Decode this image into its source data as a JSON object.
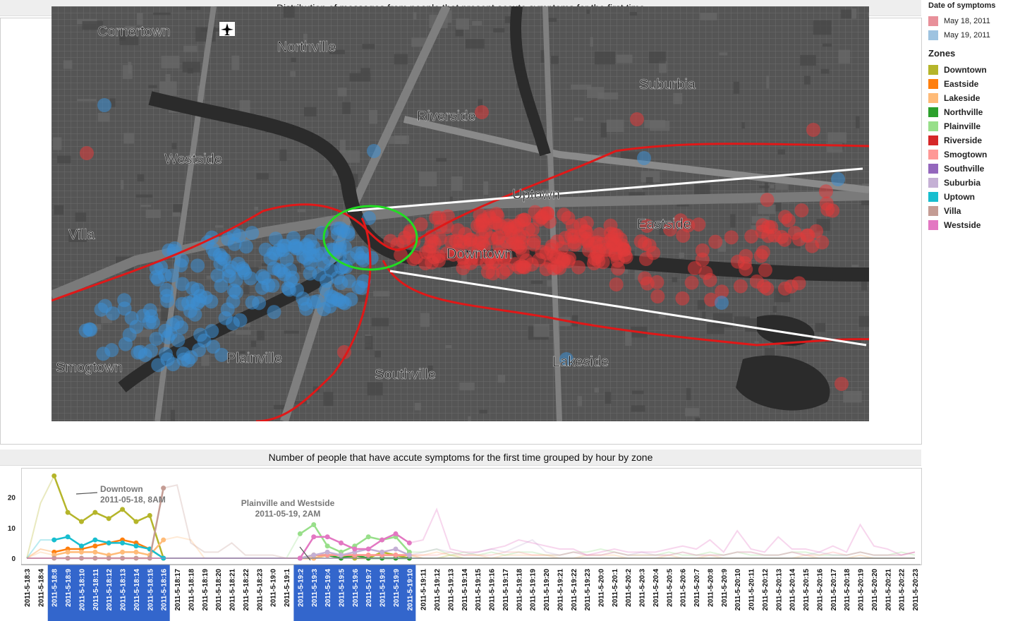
{
  "map_title": "Distribution of messages from people that present accute symptoms for the first time",
  "chart_title": "Number of people that have accute symptoms for the first time grouped by hour by zone",
  "legend_date": {
    "title": "Date of symptoms",
    "items": [
      {
        "label": "May 18, 2011",
        "color": "#e8909a"
      },
      {
        "label": "May 19, 2011",
        "color": "#9ec3e0"
      }
    ]
  },
  "legend_zones": {
    "title": "Zones",
    "items": [
      {
        "label": "Downtown",
        "color": "#b5b52a"
      },
      {
        "label": "Eastside",
        "color": "#ff7f0e"
      },
      {
        "label": "Lakeside",
        "color": "#ffbb78"
      },
      {
        "label": "Northville",
        "color": "#2ca02c"
      },
      {
        "label": "Plainville",
        "color": "#98df8a"
      },
      {
        "label": "Riverside",
        "color": "#d62728"
      },
      {
        "label": "Smogtown",
        "color": "#ff9896"
      },
      {
        "label": "Southville",
        "color": "#9467bd"
      },
      {
        "label": "Suburbia",
        "color": "#c5b0d5"
      },
      {
        "label": "Uptown",
        "color": "#17becf"
      },
      {
        "label": "Villa",
        "color": "#c49c94"
      },
      {
        "label": "Westside",
        "color": "#e377c2"
      }
    ]
  },
  "map_labels": [
    "Cornertown",
    "Northville",
    "Westside",
    "Villa",
    "Riverside",
    "Suburbia",
    "Uptown",
    "Eastside",
    "Downtown",
    "Smogtown",
    "Plainville",
    "Southville",
    "Lakeside"
  ],
  "annotations": {
    "downtown": {
      "line1": "Downtown",
      "line2": "2011-05-18, 8AM"
    },
    "plainville": {
      "line1": "Plainville and Westside",
      "line2": "2011-05-19, 2AM"
    }
  },
  "chart_data": {
    "type": "line",
    "title": "Number of people that have accute symptoms for the first time grouped by hour by zone",
    "yticks": [
      0,
      10,
      20
    ],
    "ylim": [
      0,
      28
    ],
    "x": [
      "2011-5-18:3",
      "2011-5-18:4",
      "2011-5-18:8",
      "2011-5-18:9",
      "2011-5-18:10",
      "2011-5-18:11",
      "2011-5-18:12",
      "2011-5-18:13",
      "2011-5-18:14",
      "2011-5-18:15",
      "2011-5-18:16",
      "2011-5-18:17",
      "2011-5-18:18",
      "2011-5-18:19",
      "2011-5-18:20",
      "2011-5-18:21",
      "2011-5-18:22",
      "2011-5-18:23",
      "2011-5-19:0",
      "2011-5-19:1",
      "2011-5-19:2",
      "2011-5-19:3",
      "2011-5-19:4",
      "2011-5-19:5",
      "2011-5-19:6",
      "2011-5-19:7",
      "2011-5-19:8",
      "2011-5-19:9",
      "2011-5-19:10",
      "2011-5-19:11",
      "2011-5-19:12",
      "2011-5-19:13",
      "2011-5-19:14",
      "2011-5-19:15",
      "2011-5-19:16",
      "2011-5-19:17",
      "2011-5-19:18",
      "2011-5-19:19",
      "2011-5-19:20",
      "2011-5-19:21",
      "2011-5-19:22",
      "2011-5-19:23",
      "2011-5-20:0",
      "2011-5-20:1",
      "2011-5-20:2",
      "2011-5-20:3",
      "2011-5-20:4",
      "2011-5-20:5",
      "2011-5-20:6",
      "2011-5-20:7",
      "2011-5-20:8",
      "2011-5-20:9",
      "2011-5-20:10",
      "2011-5-20:11",
      "2011-5-20:12",
      "2011-5-20:13",
      "2011-5-20:14",
      "2011-5-20:15",
      "2011-5-20:16",
      "2011-5-20:17",
      "2011-5-20:18",
      "2011-5-20:19",
      "2011-5-20:20",
      "2011-5-20:21",
      "2011-5-20:22",
      "2011-5-20:23"
    ],
    "highlighted_ranges": [
      [
        2,
        10
      ],
      [
        20,
        28
      ]
    ],
    "series": [
      {
        "name": "Downtown",
        "color": "#b5b52a",
        "values": [
          0,
          18,
          27,
          15,
          12,
          15,
          13,
          16,
          12,
          14,
          0,
          0,
          0,
          0,
          0,
          0,
          0,
          0,
          0,
          0,
          0,
          1,
          1,
          1,
          0,
          0,
          2,
          1,
          0,
          0,
          0,
          1,
          0,
          0,
          0,
          0,
          0,
          0,
          0,
          0,
          0,
          0,
          0,
          0,
          0,
          0,
          0,
          0,
          0,
          0,
          0,
          0,
          0,
          0,
          0,
          0,
          0,
          0,
          0,
          0,
          0,
          0,
          0,
          0,
          0,
          0
        ]
      },
      {
        "name": "Eastside",
        "color": "#ff7f0e",
        "values": [
          0,
          3,
          2,
          3,
          3,
          4,
          5,
          6,
          5,
          3,
          0,
          0,
          0,
          0,
          0,
          0,
          0,
          0,
          0,
          0,
          0,
          0,
          1,
          1,
          1,
          1,
          1,
          1,
          1,
          0,
          0,
          0,
          0,
          0,
          0,
          0,
          0,
          0,
          0,
          0,
          0,
          0,
          0,
          0,
          0,
          0,
          0,
          0,
          0,
          0,
          0,
          0,
          0,
          0,
          0,
          0,
          0,
          0,
          0,
          0,
          0,
          0,
          0,
          0,
          0,
          0
        ]
      },
      {
        "name": "Lakeside",
        "color": "#ffbb78",
        "values": [
          0,
          2,
          1,
          2,
          2,
          2,
          1,
          2,
          2,
          1,
          6,
          7,
          6,
          0,
          0,
          0,
          0,
          0,
          0,
          0,
          0,
          0,
          1,
          1,
          1,
          1,
          1,
          1,
          1,
          1,
          2,
          1,
          1,
          1,
          0,
          1,
          1,
          1,
          1,
          0,
          0,
          1,
          1,
          1,
          0,
          0,
          0,
          1,
          0,
          0,
          1,
          0,
          0,
          0,
          0,
          0,
          0,
          1,
          0,
          0,
          0,
          1,
          0,
          0,
          0,
          0
        ]
      },
      {
        "name": "Northville",
        "color": "#2ca02c",
        "values": [
          0,
          0,
          0,
          0,
          0,
          0,
          0,
          0,
          0,
          0,
          0,
          0,
          0,
          0,
          0,
          0,
          0,
          0,
          0,
          0,
          0,
          1,
          1,
          0,
          1,
          0,
          0,
          0,
          0,
          0,
          0,
          0,
          0,
          0,
          0,
          0,
          0,
          0,
          0,
          0,
          0,
          0,
          0,
          0,
          0,
          0,
          0,
          0,
          0,
          0,
          0,
          0,
          0,
          0,
          0,
          0,
          0,
          0,
          0,
          0,
          0,
          0,
          0,
          0,
          0,
          0
        ]
      },
      {
        "name": "Plainville",
        "color": "#98df8a",
        "values": [
          0,
          0,
          0,
          0,
          0,
          0,
          0,
          0,
          0,
          0,
          0,
          0,
          0,
          0,
          0,
          0,
          0,
          0,
          0,
          0,
          8,
          11,
          4,
          2,
          4,
          7,
          6,
          7,
          2,
          2,
          3,
          1,
          2,
          1,
          2,
          1,
          2,
          2,
          1,
          1,
          2,
          2,
          3,
          2,
          1,
          1,
          1,
          2,
          1,
          1,
          2,
          1,
          2,
          1,
          1,
          1,
          2,
          2,
          1,
          1,
          1,
          2,
          1,
          1,
          2,
          1
        ]
      },
      {
        "name": "Riverside",
        "color": "#d62728",
        "values": [
          0,
          0,
          0,
          0,
          0,
          0,
          0,
          0,
          0,
          0,
          0,
          0,
          0,
          0,
          0,
          0,
          0,
          0,
          0,
          0,
          0,
          0,
          0,
          0,
          0,
          0,
          0,
          0,
          0,
          0,
          0,
          0,
          0,
          0,
          0,
          0,
          0,
          0,
          0,
          0,
          0,
          0,
          0,
          0,
          0,
          0,
          0,
          0,
          0,
          0,
          0,
          0,
          0,
          0,
          0,
          0,
          0,
          0,
          0,
          0,
          0,
          0,
          0,
          0,
          0,
          0
        ]
      },
      {
        "name": "Smogtown",
        "color": "#ff9896",
        "values": [
          0,
          0,
          0,
          0,
          0,
          0,
          0,
          0,
          0,
          0,
          0,
          0,
          0,
          0,
          0,
          0,
          0,
          0,
          0,
          0,
          0,
          1,
          1,
          1,
          1,
          1,
          1,
          1,
          1,
          1,
          1,
          2,
          1,
          1,
          1,
          2,
          2,
          1,
          1,
          1,
          2,
          1,
          1,
          2,
          1,
          1,
          1,
          1,
          2,
          1,
          1,
          1,
          2,
          2,
          1,
          1,
          2,
          1,
          1,
          2,
          1,
          2,
          1,
          1,
          1,
          2
        ]
      },
      {
        "name": "Southville",
        "color": "#9467bd",
        "values": [
          0,
          0,
          0,
          0,
          0,
          0,
          0,
          0,
          0,
          0,
          0,
          0,
          0,
          0,
          0,
          0,
          0,
          0,
          0,
          0,
          0,
          0,
          0,
          0,
          0,
          0,
          0,
          0,
          0,
          0,
          0,
          0,
          0,
          0,
          0,
          0,
          0,
          0,
          0,
          0,
          0,
          0,
          0,
          0,
          0,
          0,
          0,
          0,
          0,
          0,
          0,
          0,
          0,
          0,
          0,
          0,
          0,
          0,
          0,
          0,
          0,
          0,
          0,
          0,
          0,
          0
        ]
      },
      {
        "name": "Suburbia",
        "color": "#c5b0d5",
        "values": [
          0,
          0,
          0,
          0,
          0,
          0,
          0,
          0,
          0,
          0,
          0,
          0,
          0,
          0,
          0,
          0,
          0,
          0,
          0,
          0,
          0,
          1,
          2,
          1,
          2,
          3,
          2,
          3,
          1,
          2,
          3,
          2,
          1,
          2,
          3,
          2,
          4,
          6,
          2,
          1,
          2,
          1,
          1,
          2,
          1,
          2,
          1,
          1,
          2,
          1,
          1,
          1,
          2,
          2,
          1,
          1,
          2,
          1,
          2,
          1,
          1,
          2,
          1,
          1,
          1,
          2
        ]
      },
      {
        "name": "Uptown",
        "color": "#17becf",
        "values": [
          0,
          6,
          6,
          7,
          4,
          6,
          5,
          5,
          4,
          3,
          0,
          0,
          0,
          0,
          0,
          0,
          0,
          0,
          0,
          0,
          0,
          0,
          0,
          0,
          0,
          0,
          0,
          0,
          0,
          0,
          0,
          0,
          0,
          0,
          0,
          0,
          0,
          0,
          0,
          0,
          0,
          0,
          0,
          0,
          0,
          0,
          0,
          0,
          0,
          0,
          0,
          0,
          0,
          0,
          0,
          0,
          0,
          0,
          0,
          0,
          0,
          0,
          0,
          0,
          0,
          0
        ]
      },
      {
        "name": "Villa",
        "color": "#c49c94",
        "values": [
          0,
          0,
          0,
          0,
          0,
          0,
          0,
          0,
          0,
          0,
          23,
          24,
          5,
          2,
          2,
          5,
          1,
          1,
          1,
          0,
          0,
          0,
          0,
          0,
          0,
          0,
          0,
          0,
          0,
          0,
          0,
          0,
          0,
          0,
          0,
          0,
          0,
          0,
          0,
          0,
          0,
          0,
          0,
          0,
          0,
          0,
          0,
          0,
          0,
          0,
          0,
          0,
          0,
          0,
          0,
          0,
          0,
          0,
          0,
          0,
          0,
          0,
          0,
          0,
          0,
          0
        ]
      },
      {
        "name": "Westside",
        "color": "#e377c2",
        "values": [
          0,
          0,
          0,
          0,
          0,
          0,
          0,
          0,
          0,
          0,
          0,
          0,
          0,
          0,
          0,
          0,
          0,
          0,
          0,
          0,
          0,
          7,
          7,
          5,
          3,
          3,
          6,
          8,
          5,
          6,
          16,
          3,
          2,
          2,
          3,
          4,
          6,
          5,
          4,
          3,
          3,
          1,
          2,
          3,
          2,
          2,
          2,
          3,
          4,
          3,
          6,
          2,
          9,
          3,
          2,
          7,
          3,
          3,
          2,
          4,
          2,
          11,
          4,
          3,
          1,
          2
        ]
      }
    ]
  }
}
